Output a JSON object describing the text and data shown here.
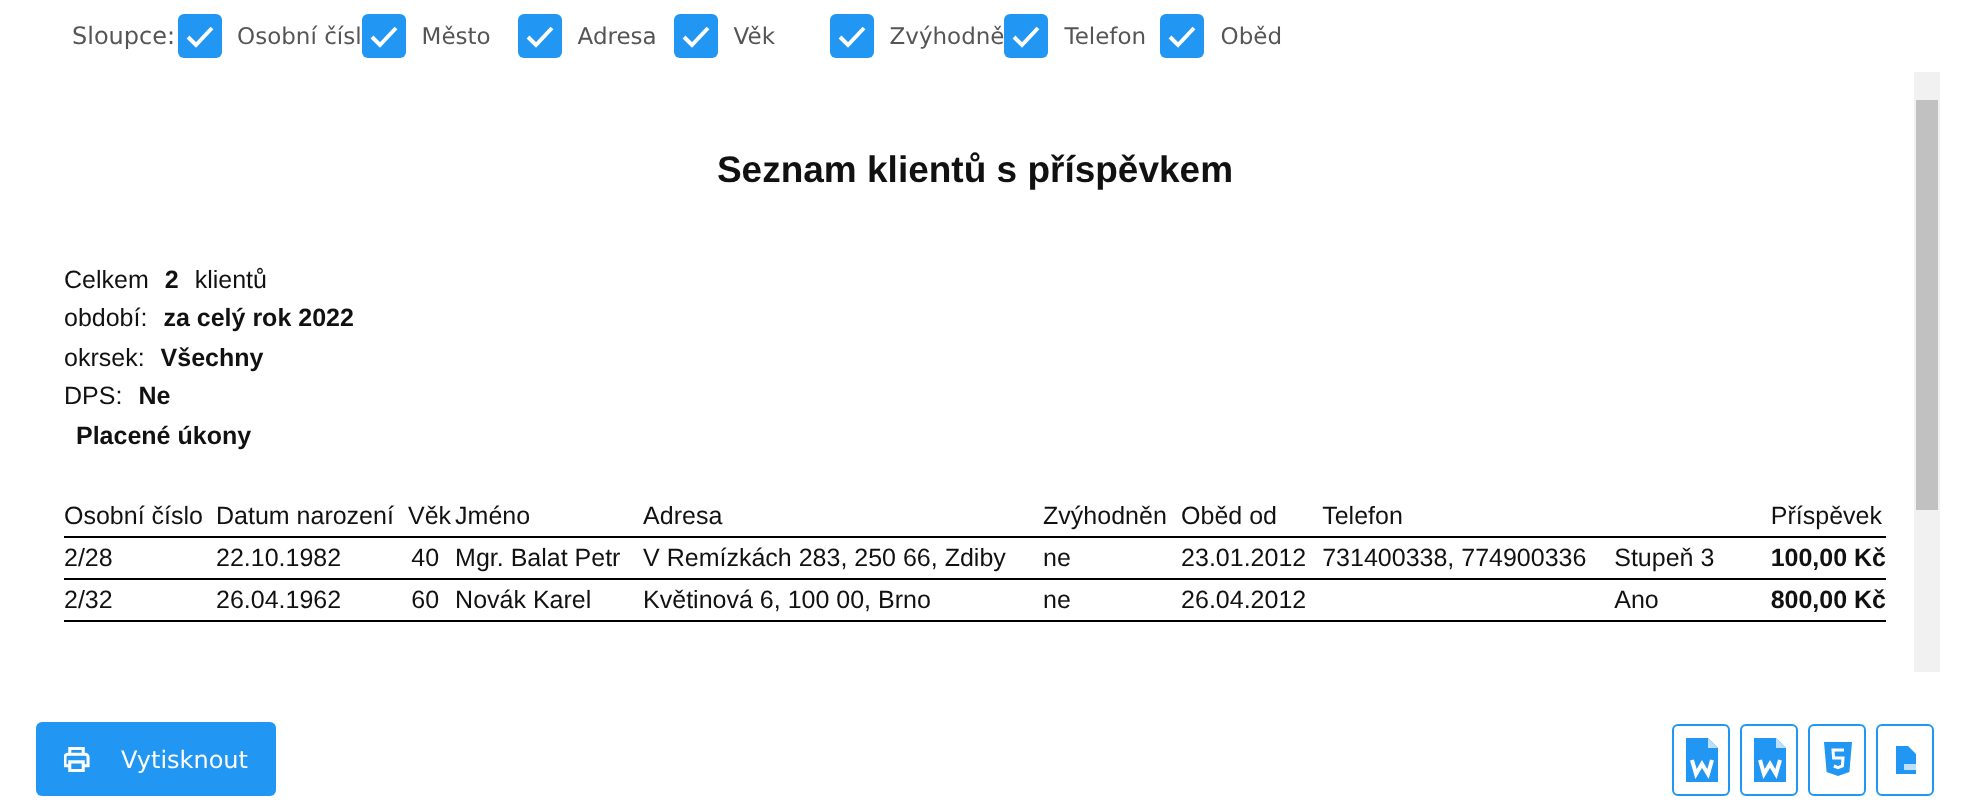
{
  "columns_label": "Sloupce:",
  "column_toggles": [
    {
      "label": "Osobní čísl",
      "checked": true
    },
    {
      "label": "Město",
      "checked": true
    },
    {
      "label": "Adresa",
      "checked": true
    },
    {
      "label": "Věk",
      "checked": true
    },
    {
      "label": "Zvýhodně",
      "checked": true
    },
    {
      "label": "Telefon",
      "checked": true
    },
    {
      "label": "Oběd",
      "checked": true
    }
  ],
  "report": {
    "title": "Seznam klientů s příspěvkem",
    "summary": [
      {
        "label": "Celkem",
        "value": "2",
        "suffix": "klientů"
      },
      {
        "label": "období:",
        "value": "za celý rok 2022"
      },
      {
        "label": "okrsek:",
        "value": "Všechny"
      },
      {
        "label": "DPS:",
        "value": "Ne"
      },
      {
        "value": "Placené úkony"
      }
    ],
    "table": {
      "columns": [
        "Osobní číslo",
        "Datum narození",
        "Věk",
        "Jméno",
        "Adresa",
        "Zvýhodněn",
        "Oběd od",
        "Telefon",
        "",
        "Příspěvek"
      ],
      "rows": [
        [
          "2/28",
          "22.10.1982",
          "40",
          "Mgr. Balat Petr",
          "V Remízkách 283, 250 66, Zdiby",
          "ne",
          "23.01.2012",
          "731400338, 774900336",
          "Stupeň 3",
          "100,00 Kč"
        ],
        [
          "2/32",
          "26.04.1962",
          "60",
          "Novák Karel",
          "Květinová 6, 100 00, Brno",
          "ne",
          "26.04.2012",
          "",
          "Ano",
          "800,00 Kč"
        ]
      ]
    }
  },
  "print_button": "Vytisknout",
  "export_buttons": [
    {
      "kind": "word"
    },
    {
      "kind": "word"
    },
    {
      "kind": "html"
    },
    {
      "kind": "pdf"
    }
  ]
}
